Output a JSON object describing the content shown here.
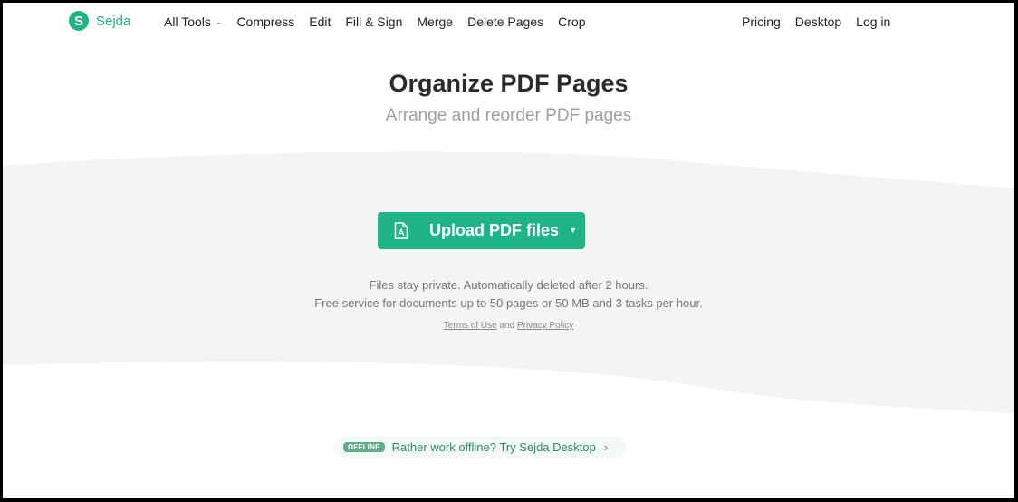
{
  "brand": {
    "name": "Sejda",
    "mark": "S",
    "color": "#1fb485"
  },
  "nav": {
    "left": [
      {
        "label": "All Tools",
        "has_dropdown": true
      },
      {
        "label": "Compress"
      },
      {
        "label": "Edit"
      },
      {
        "label": "Fill & Sign"
      },
      {
        "label": "Merge"
      },
      {
        "label": "Delete Pages"
      },
      {
        "label": "Crop"
      }
    ],
    "right": [
      {
        "label": "Pricing"
      },
      {
        "label": "Desktop"
      },
      {
        "label": "Log in"
      }
    ]
  },
  "hero": {
    "title": "Organize PDF Pages",
    "subtitle": "Arrange and reorder PDF pages"
  },
  "upload": {
    "label": "Upload PDF files",
    "icon": "pdf-file-icon",
    "dropdown_icon": "caret-down-icon"
  },
  "info": {
    "line1": "Files stay private. Automatically deleted after 2 hours.",
    "line2": "Free service for documents up to 50 pages or 50 MB and 3 tasks per hour.",
    "terms_label": "Terms of Use",
    "and": "and",
    "privacy_label": "Privacy Policy"
  },
  "offline_promo": {
    "badge": "OFFLINE",
    "text": "Rather work offline? Try Sejda Desktop",
    "arrow": "›"
  },
  "colors": {
    "accent": "#1fb485",
    "band_bg": "#f4f4f4",
    "badge": "#63ad8e",
    "promo_text": "#2b8a68"
  }
}
